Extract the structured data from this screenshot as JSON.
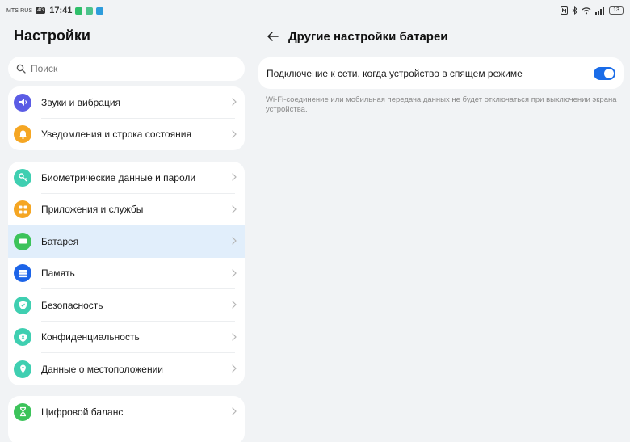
{
  "status_bar": {
    "carrier": "MTS RUS",
    "carrier_tag": "4G",
    "time": "17:41",
    "battery": "13"
  },
  "settings": {
    "title": "Настройки",
    "search_placeholder": "Поиск"
  },
  "groups": [
    {
      "items": [
        {
          "label": "Звуки и вибрация",
          "icon": "speaker-icon",
          "color": "#5b5ce5"
        },
        {
          "label": "Уведомления и строка состояния",
          "icon": "bell-icon",
          "color": "#f5a623"
        }
      ]
    },
    {
      "items": [
        {
          "label": "Биометрические данные и пароли",
          "icon": "key-icon",
          "color": "#3fcfb1"
        },
        {
          "label": "Приложения и службы",
          "icon": "apps-icon",
          "color": "#f5a623"
        },
        {
          "label": "Батарея",
          "icon": "battery-icon",
          "color": "#3cc35a",
          "active": true
        },
        {
          "label": "Память",
          "icon": "storage-icon",
          "color": "#1c64e8"
        },
        {
          "label": "Безопасность",
          "icon": "shield-icon",
          "color": "#3fcfb1"
        },
        {
          "label": "Конфиденциальность",
          "icon": "privacy-icon",
          "color": "#3fcfb1"
        },
        {
          "label": "Данные о местоположении",
          "icon": "location-icon",
          "color": "#3fcfb1"
        }
      ]
    },
    {
      "items": [
        {
          "label": "Цифровой баланс",
          "icon": "hourglass-icon",
          "color": "#3cc35a"
        }
      ]
    }
  ],
  "detail": {
    "title": "Другие настройки батареи",
    "option_label": "Подключение к сети, когда устройство в спящем режиме",
    "option_enabled": true,
    "description": "Wi-Fi-соединение или мобильная передача данных не будет отключаться при выключении экрана устройства."
  }
}
